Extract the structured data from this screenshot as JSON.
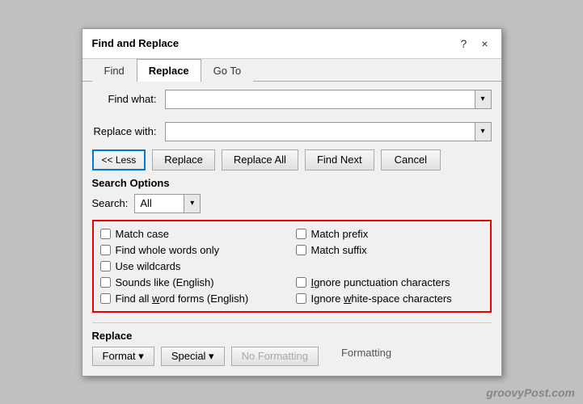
{
  "dialog": {
    "title": "Find and Replace",
    "help_icon": "?",
    "close_icon": "×"
  },
  "tabs": [
    {
      "label": "Find",
      "active": false
    },
    {
      "label": "Replace",
      "active": true
    },
    {
      "label": "Go To",
      "active": false
    }
  ],
  "find_what": {
    "label": "Find what:",
    "value": "",
    "placeholder": ""
  },
  "replace_with": {
    "label": "Replace with:",
    "value": "",
    "placeholder": ""
  },
  "buttons": {
    "less": "<< Less",
    "replace": "Replace",
    "replace_all": "Replace All",
    "find_next": "Find Next",
    "cancel": "Cancel"
  },
  "search_options": {
    "section_label": "Search Options",
    "search_label": "Search:",
    "search_value": "All"
  },
  "checkboxes": [
    {
      "id": "match-case",
      "label": "Match case",
      "checked": false,
      "col": 1
    },
    {
      "id": "find-whole-words",
      "label": "Find whole words only",
      "checked": false,
      "col": 1
    },
    {
      "id": "use-wildcards",
      "label": "Use wildcards",
      "checked": false,
      "col": 1
    },
    {
      "id": "sounds-like",
      "label": "Sounds like (English)",
      "checked": false,
      "col": 1
    },
    {
      "id": "find-all-word-forms",
      "label": "Find all word forms (English)",
      "checked": false,
      "col": 1
    },
    {
      "id": "match-prefix",
      "label": "Match prefix",
      "checked": false,
      "col": 2
    },
    {
      "id": "match-suffix",
      "label": "Match suffix",
      "checked": false,
      "col": 2
    },
    {
      "id": "ignore-punctuation",
      "label": "Ignore punctuation characters",
      "checked": false,
      "col": 2
    },
    {
      "id": "ignore-whitespace",
      "label": "Ignore white-space characters",
      "checked": false,
      "col": 2
    }
  ],
  "replace_section": {
    "label": "Replace",
    "format_btn": "Format ▾",
    "special_btn": "Special ▾",
    "no_formatting_btn": "No Formatting",
    "formatting_label": "Formatting"
  },
  "watermark": "groovyPost.com"
}
